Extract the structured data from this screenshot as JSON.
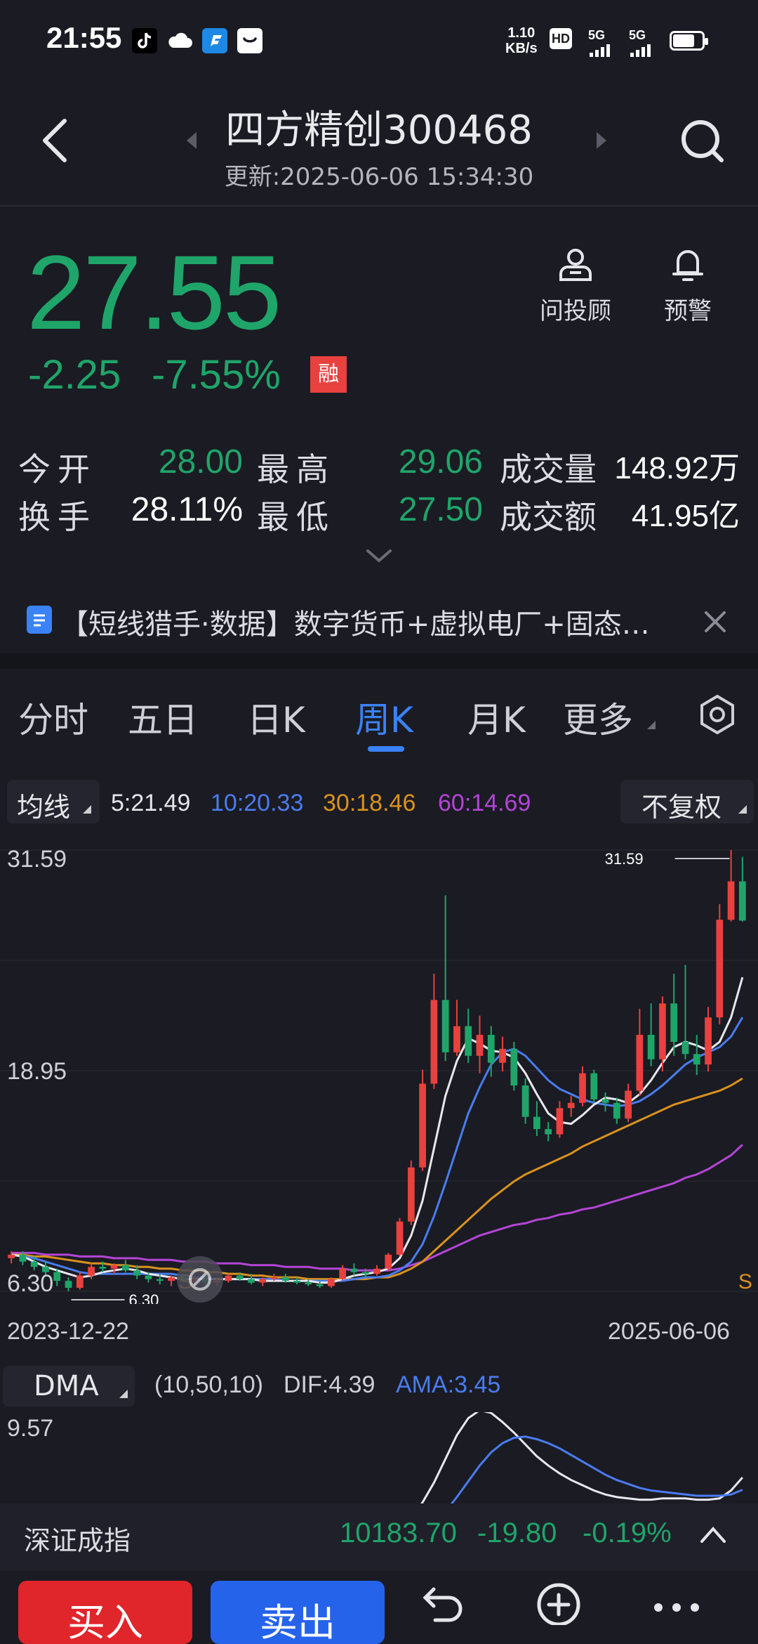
{
  "status_bar": {
    "time": "21:55",
    "net_speed_value": "1.10",
    "net_speed_unit": "KB/s",
    "hd_label": "HD",
    "sim1_label": "5G",
    "sim2_label": "5G"
  },
  "header": {
    "title": "四方精创300468",
    "updated": "更新:2025-06-06 15:34:30"
  },
  "quote": {
    "price": "27.55",
    "change": "-2.25",
    "change_pct": "-7.55%",
    "margin_badge": "融",
    "advisor_label": "问投顾",
    "alert_label": "预警"
  },
  "stats": [
    {
      "label": "今开",
      "value": "28.00",
      "tone": "green"
    },
    {
      "label": "最高",
      "value": "29.06",
      "tone": "green"
    },
    {
      "label": "成交量",
      "value": "148.92万",
      "tone": "white"
    },
    {
      "label": "换手",
      "value": "28.11%",
      "tone": "white"
    },
    {
      "label": "最低",
      "value": "27.50",
      "tone": "green"
    },
    {
      "label": "成交额",
      "value": "41.95亿",
      "tone": "white"
    }
  ],
  "news": {
    "text": "【短线猎手·数据】数字货币+虚拟电厂+固态…"
  },
  "tabs": [
    "分时",
    "五日",
    "日K",
    "周K",
    "月K",
    "更多"
  ],
  "active_tab": "周K",
  "ma_bar": {
    "selector": "均线",
    "ma5": "5:21.49",
    "ma10": "10:20.33",
    "ma30": "30:18.46",
    "ma60": "60:14.69",
    "adjust": "不复权"
  },
  "colors": {
    "up": "#e8413e",
    "down": "#1fa56a",
    "ma5": "#e8e8ee",
    "ma10": "#4a7cf0",
    "ma30": "#d9921e",
    "ma60": "#b445d6",
    "accent": "#3b82f6"
  },
  "chart_data": {
    "type": "candlestick",
    "y_ticks": [
      "31.59",
      "18.95",
      "6.30"
    ],
    "x_start": "2023-12-22",
    "x_end": "2025-06-06",
    "max_marker": "31.59",
    "min_marker": "6.30",
    "signal_label": "S",
    "indicator": {
      "name": "DMA",
      "params": "(10,50,10)",
      "dif": "DIF:4.39",
      "ama": "AMA:3.45",
      "top_value": "9.57"
    },
    "candles": [
      [
        8.2,
        8.6,
        7.9,
        8.4
      ],
      [
        8.4,
        8.6,
        7.8,
        8.0
      ],
      [
        8.0,
        8.3,
        7.5,
        7.7
      ],
      [
        7.7,
        8.0,
        7.2,
        7.4
      ],
      [
        7.4,
        7.6,
        6.6,
        6.9
      ],
      [
        6.9,
        7.1,
        6.3,
        6.5
      ],
      [
        6.5,
        7.4,
        6.4,
        7.2
      ],
      [
        7.2,
        7.9,
        7.0,
        7.7
      ],
      [
        7.7,
        8.0,
        7.4,
        7.6
      ],
      [
        7.6,
        7.9,
        7.3,
        7.8
      ],
      [
        7.8,
        8.1,
        7.4,
        7.5
      ],
      [
        7.5,
        7.8,
        7.0,
        7.2
      ],
      [
        7.2,
        7.4,
        6.8,
        7.0
      ],
      [
        7.0,
        7.3,
        6.7,
        6.9
      ],
      [
        6.9,
        7.2,
        6.6,
        7.1
      ],
      [
        7.1,
        7.3,
        6.8,
        6.9
      ],
      [
        6.9,
        7.2,
        6.7,
        7.0
      ],
      [
        7.0,
        7.2,
        6.7,
        6.8
      ],
      [
        6.8,
        7.1,
        6.6,
        6.9
      ],
      [
        6.9,
        7.3,
        6.8,
        7.2
      ],
      [
        7.2,
        7.4,
        6.9,
        7.0
      ],
      [
        7.0,
        7.3,
        6.7,
        6.8
      ],
      [
        6.8,
        7.1,
        6.6,
        7.0
      ],
      [
        7.0,
        7.3,
        6.9,
        7.1
      ],
      [
        7.1,
        7.3,
        6.8,
        6.9
      ],
      [
        6.9,
        7.1,
        6.7,
        6.8
      ],
      [
        6.8,
        7.0,
        6.6,
        6.7
      ],
      [
        6.7,
        6.9,
        6.5,
        6.6
      ],
      [
        6.6,
        7.1,
        6.5,
        7.0
      ],
      [
        7.0,
        7.8,
        6.9,
        7.6
      ],
      [
        7.6,
        7.9,
        7.2,
        7.4
      ],
      [
        7.4,
        7.6,
        7.1,
        7.3
      ],
      [
        7.3,
        7.8,
        7.2,
        7.6
      ],
      [
        7.6,
        8.5,
        7.5,
        8.4
      ],
      [
        8.4,
        10.5,
        8.3,
        10.3
      ],
      [
        10.3,
        13.8,
        10.1,
        13.4
      ],
      [
        13.4,
        19.0,
        13.2,
        18.2
      ],
      [
        18.2,
        24.5,
        17.9,
        23.0
      ],
      [
        23.0,
        29.0,
        19.5,
        20.0
      ],
      [
        20.0,
        23.0,
        19.8,
        21.5
      ],
      [
        21.5,
        22.5,
        19.4,
        19.8
      ],
      [
        19.8,
        22.1,
        18.8,
        21.0
      ],
      [
        21.0,
        21.5,
        18.6,
        19.4
      ],
      [
        19.4,
        20.9,
        18.9,
        20.2
      ],
      [
        20.2,
        20.6,
        17.8,
        18.1
      ],
      [
        18.1,
        18.5,
        15.9,
        16.3
      ],
      [
        16.3,
        17.2,
        15.2,
        15.6
      ],
      [
        15.6,
        16.0,
        14.9,
        15.3
      ],
      [
        15.3,
        17.2,
        15.1,
        16.8
      ],
      [
        16.8,
        17.5,
        16.3,
        17.1
      ],
      [
        17.1,
        19.2,
        16.9,
        18.8
      ],
      [
        18.8,
        19.0,
        17.1,
        17.3
      ],
      [
        17.3,
        17.7,
        16.6,
        17.1
      ],
      [
        17.1,
        17.4,
        15.9,
        16.2
      ],
      [
        16.2,
        18.2,
        16.0,
        17.8
      ],
      [
        17.8,
        22.5,
        17.5,
        21.0
      ],
      [
        21.0,
        22.8,
        19.2,
        19.6
      ],
      [
        19.6,
        23.2,
        18.9,
        22.8
      ],
      [
        22.8,
        24.5,
        19.8,
        20.6
      ],
      [
        20.6,
        25.0,
        19.6,
        19.9
      ],
      [
        19.9,
        21.0,
        18.7,
        19.3
      ],
      [
        19.3,
        22.6,
        18.9,
        22.0
      ],
      [
        22.0,
        28.5,
        21.6,
        27.6
      ],
      [
        27.6,
        31.59,
        27.5,
        29.8
      ],
      [
        29.8,
        31.2,
        27.5,
        27.55
      ]
    ],
    "ma5_line": [
      8.4,
      8.3,
      8.0,
      7.7,
      7.5,
      7.3,
      7.1,
      7.2,
      7.4,
      7.5,
      7.6,
      7.5,
      7.3,
      7.2,
      7.1,
      7.0,
      7.0,
      7.0,
      7.0,
      7.0,
      7.0,
      7.0,
      6.9,
      6.9,
      6.9,
      6.9,
      6.9,
      6.8,
      6.8,
      7.0,
      7.2,
      7.3,
      7.4,
      7.6,
      8.2,
      9.5,
      11.5,
      14.5,
      17.5,
      19.5,
      20.8,
      20.5,
      20.1,
      20.0,
      19.7,
      18.8,
      17.6,
      16.5,
      16.0,
      15.9,
      16.4,
      17.0,
      17.4,
      17.3,
      17.1,
      17.6,
      18.4,
      19.4,
      20.3,
      20.6,
      20.4,
      20.1,
      20.6,
      22.0,
      24.3
    ],
    "ma10_line": [
      8.4,
      8.3,
      8.2,
      8.0,
      7.8,
      7.6,
      7.4,
      7.3,
      7.3,
      7.3,
      7.3,
      7.3,
      7.3,
      7.3,
      7.3,
      7.2,
      7.1,
      7.1,
      7.0,
      7.0,
      7.0,
      7.0,
      7.0,
      7.0,
      6.9,
      6.9,
      6.9,
      6.9,
      6.9,
      6.9,
      7.0,
      7.1,
      7.1,
      7.2,
      7.5,
      8.0,
      9.0,
      10.6,
      12.5,
      14.5,
      16.5,
      18.0,
      19.3,
      20.0,
      20.2,
      19.8,
      19.1,
      18.4,
      17.9,
      17.6,
      17.3,
      17.1,
      17.0,
      16.9,
      17.0,
      17.2,
      17.6,
      18.1,
      18.7,
      19.3,
      19.7,
      20.0,
      20.3,
      20.9,
      22.0
    ],
    "ma30_line": [
      8.4,
      8.4,
      8.3,
      8.3,
      8.2,
      8.1,
      8.0,
      7.9,
      7.9,
      7.8,
      7.8,
      7.7,
      7.7,
      7.6,
      7.6,
      7.5,
      7.5,
      7.4,
      7.4,
      7.3,
      7.3,
      7.2,
      7.2,
      7.1,
      7.1,
      7.1,
      7.0,
      7.0,
      7.0,
      7.0,
      7.0,
      7.0,
      7.1,
      7.1,
      7.3,
      7.6,
      8.0,
      8.6,
      9.2,
      9.8,
      10.4,
      11.0,
      11.6,
      12.1,
      12.6,
      13.0,
      13.3,
      13.6,
      13.9,
      14.2,
      14.6,
      14.9,
      15.2,
      15.5,
      15.8,
      16.1,
      16.4,
      16.7,
      17.0,
      17.2,
      17.4,
      17.6,
      17.8,
      18.1,
      18.5
    ],
    "ma60_line": [
      8.5,
      8.5,
      8.5,
      8.4,
      8.4,
      8.4,
      8.3,
      8.3,
      8.3,
      8.2,
      8.2,
      8.2,
      8.1,
      8.1,
      8.1,
      8.0,
      8.0,
      8.0,
      7.9,
      7.9,
      7.9,
      7.8,
      7.8,
      7.8,
      7.7,
      7.7,
      7.7,
      7.6,
      7.6,
      7.6,
      7.5,
      7.5,
      7.5,
      7.5,
      7.6,
      7.8,
      8.0,
      8.3,
      8.6,
      8.9,
      9.2,
      9.5,
      9.7,
      9.9,
      10.1,
      10.2,
      10.4,
      10.5,
      10.7,
      10.8,
      11.0,
      11.1,
      11.3,
      11.5,
      11.7,
      11.9,
      12.1,
      12.3,
      12.5,
      12.8,
      13.0,
      13.3,
      13.7,
      14.1,
      14.7
    ],
    "dma_dif": [
      0,
      0,
      0,
      0,
      0,
      0,
      0,
      0,
      0,
      0,
      0,
      0,
      0,
      0,
      0,
      0,
      0,
      0,
      0,
      0,
      0,
      0,
      0,
      0,
      0,
      0,
      0,
      0,
      0,
      0,
      0,
      0,
      0,
      0,
      0.4,
      1.2,
      2.5,
      4.0,
      5.8,
      7.6,
      8.9,
      9.5,
      9.3,
      8.6,
      7.8,
      6.9,
      6.0,
      5.3,
      4.7,
      4.2,
      3.8,
      3.4,
      3.1,
      2.9,
      2.8,
      2.7,
      2.7,
      2.8,
      2.8,
      2.8,
      2.7,
      2.7,
      2.8,
      3.4,
      4.39
    ],
    "dma_ama": [
      0,
      0,
      0,
      0,
      0,
      0,
      0,
      0,
      0,
      0,
      0,
      0,
      0,
      0,
      0,
      0,
      0,
      0,
      0,
      0,
      0,
      0,
      0,
      0,
      0,
      0,
      0,
      0,
      0,
      0,
      0,
      0,
      0,
      0,
      0,
      0,
      0.3,
      0.9,
      1.8,
      2.9,
      4.1,
      5.3,
      6.3,
      7.0,
      7.4,
      7.5,
      7.3,
      7.0,
      6.6,
      6.1,
      5.6,
      5.1,
      4.6,
      4.2,
      3.9,
      3.6,
      3.4,
      3.3,
      3.2,
      3.1,
      3.0,
      3.0,
      3.0,
      3.1,
      3.45
    ]
  },
  "index_bar": {
    "name": "深证成指",
    "value": "10183.70",
    "change": "-19.80",
    "change_pct": "-0.19%"
  },
  "actions": {
    "buy": "买入",
    "sell": "卖出"
  }
}
